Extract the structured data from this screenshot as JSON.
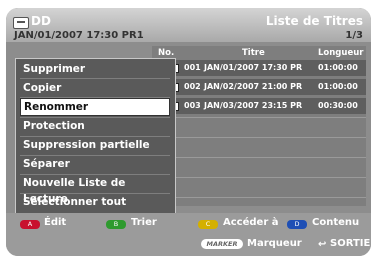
{
  "header": {
    "device_name": "DD",
    "screen_title": "Liste de Titres",
    "info_line": "JAN/01/2007 17:30 PR1",
    "page_count": "1/3"
  },
  "list": {
    "columns": {
      "no": "No.",
      "title": "Titre",
      "length": "Longueur"
    },
    "rows": [
      {
        "no": "001",
        "title": "JAN/01/2007 17:30 PR",
        "length": "01:00:00"
      },
      {
        "no": "002",
        "title": "JAN/02/2007 21:00 PR",
        "length": "01:00:00"
      },
      {
        "no": "003",
        "title": "JAN/03/2007 23:15 PR",
        "length": "00:30:00"
      }
    ]
  },
  "menu": {
    "items": [
      "Supprimer",
      "Copier",
      "Renommer",
      "Protection",
      "Suppression partielle",
      "Séparer",
      "Nouvelle Liste de Lecture",
      "Sélectionner tout"
    ],
    "selected_index": 2
  },
  "footer": {
    "buttons": [
      {
        "key": "A",
        "label": "Édit",
        "color": "#c8102e"
      },
      {
        "key": "B",
        "label": "Trier",
        "color": "#2e9a2e"
      },
      {
        "key": "C",
        "label": "Accéder à",
        "color": "#d4b000"
      },
      {
        "key": "D",
        "label": "Contenu",
        "color": "#1e4fb5"
      }
    ],
    "marker_key": "MARKER",
    "marker_label": "Marqueur",
    "return_label": "SORTIE"
  }
}
